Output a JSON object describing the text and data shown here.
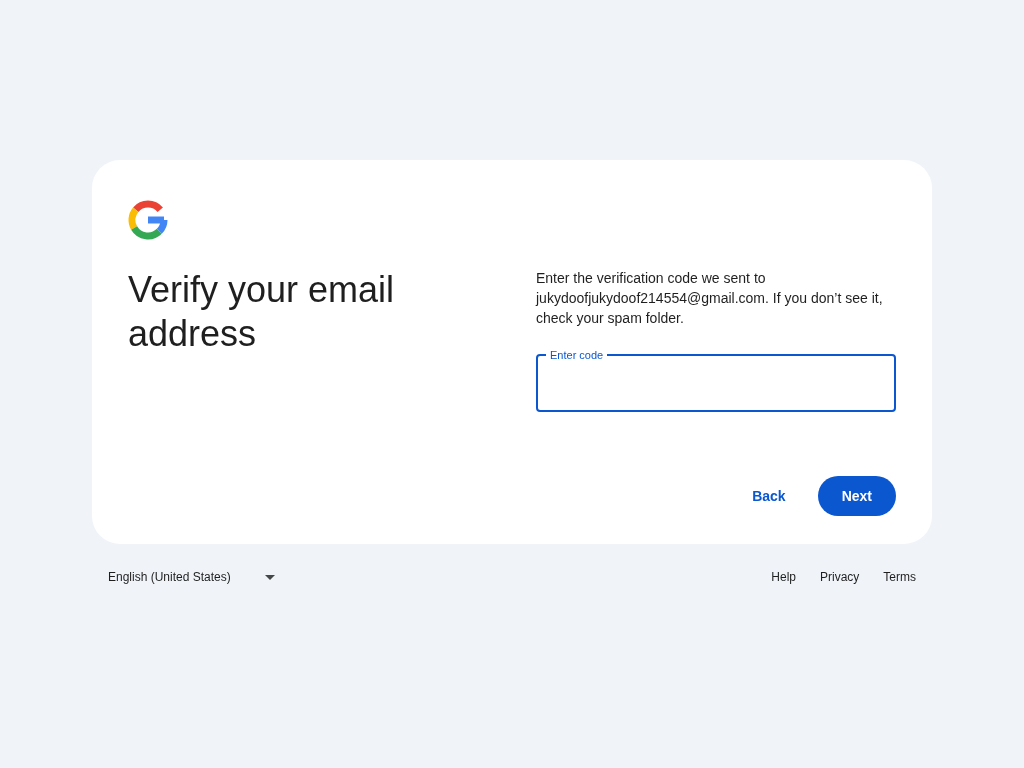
{
  "heading": "Verify your email address",
  "instructions": "Enter the verification code we sent to jukydoofjukydoof214554@gmail.com. If you don’t see it, check your spam folder.",
  "code_field": {
    "label": "Enter code",
    "focused": true
  },
  "buttons": [
    {
      "label": "Back",
      "kind": "text"
    },
    {
      "label": "Next",
      "kind": "filled"
    }
  ],
  "footer": {
    "language": "English (United States)",
    "links": [
      "Help",
      "Privacy",
      "Terms"
    ]
  }
}
